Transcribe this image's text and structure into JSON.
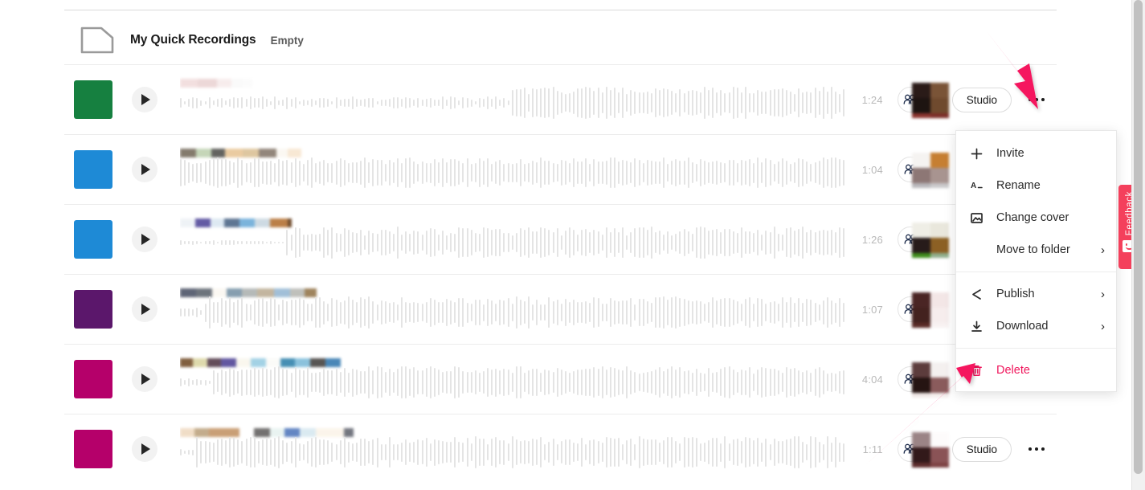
{
  "folder": {
    "icon": "folder-icon",
    "name": "My Quick Recordings",
    "status": "Empty"
  },
  "rows": [
    {
      "thumb_color": "#168040",
      "duration": "1:24",
      "studio_label": "Studio",
      "has_studio": true,
      "play_icon": "play-icon",
      "people_icon": "people-icon",
      "kebab_icon": "more-options-icon",
      "title_blur_colors": [
        "#f2dede",
        "#ecd6d6",
        "#f7ecec",
        "#fafafa",
        "#fbfbfb"
      ],
      "title_blur_widths": [
        22,
        24,
        18,
        14,
        12
      ],
      "avatar_blur_colors": [
        "#2a1b18",
        "#7a5437",
        "#1d1411",
        "#6f4a2e",
        "#8c3530",
        "#7d2f29"
      ]
    },
    {
      "thumb_color": "#1e8ad6",
      "duration": "1:04",
      "studio_label": "Studio",
      "has_studio": false,
      "play_icon": "play-icon",
      "people_icon": "people-icon",
      "kebab_icon": "more-options-icon",
      "title_blur_colors": [
        "#7e7465",
        "#c2d4b5",
        "#5b5b57",
        "#e9c99c",
        "#ddc49b",
        "#8d8074",
        "#fbf8f2",
        "#f8e7d2"
      ],
      "title_blur_widths": [
        20,
        19,
        17,
        22,
        20,
        22,
        14,
        17
      ],
      "avatar_blur_colors": [
        "#f5f3f1",
        "#c67f32",
        "#8d7775",
        "#a89490",
        "#b9b8bb",
        "#c9c8ca"
      ]
    },
    {
      "thumb_color": "#1e8ad6",
      "duration": "1:26",
      "studio_label": "Studio",
      "has_studio": false,
      "play_icon": "play-icon",
      "people_icon": "people-icon",
      "kebab_icon": "more-options-icon",
      "title_blur_colors": [
        "#eef2f6",
        "#5b52a0",
        "#dce8f2",
        "#566f8e",
        "#74b0da",
        "#ccd9e2",
        "#b8793e",
        "#6a4423"
      ],
      "title_blur_widths": [
        19,
        19,
        17,
        19,
        19,
        19,
        22,
        5
      ],
      "avatar_blur_colors": [
        "#efeee6",
        "#e9e7dc",
        "#271b1a",
        "#8c6024",
        "#3f8d1c",
        "#8fae8b",
        "#b02a22",
        "#2f5d16"
      ]
    },
    {
      "thumb_color": "#5b176b",
      "duration": "1:07",
      "studio_label": "Studio",
      "has_studio": false,
      "play_icon": "play-icon",
      "people_icon": "people-icon",
      "kebab_icon": "more-options-icon",
      "title_blur_colors": [
        "#565d6f",
        "#666d76",
        "#fbf8f2",
        "#8099ab",
        "#b2b7b5",
        "#c0b29a",
        "#9dbcd6",
        "#bcbdb8",
        "#9a7e55"
      ],
      "title_blur_widths": [
        20,
        20,
        18,
        19,
        19,
        21,
        20,
        18,
        15
      ],
      "avatar_blur_colors": [
        "#4a2524",
        "#f3e6e6",
        "#43221f",
        "#f6eded",
        "#5a2b27",
        "#f8f2f2"
      ]
    },
    {
      "thumb_color": "#b5006a",
      "duration": "4:04",
      "studio_label": "Studio",
      "has_studio": false,
      "play_icon": "play-icon",
      "people_icon": "people-icon",
      "kebab_icon": "more-options-icon",
      "title_blur_colors": [
        "#7b5634",
        "#ddd8a8",
        "#5c4452",
        "#5a4f9c",
        "#faf7ee",
        "#9fd0e4",
        "#fbfbf8",
        "#3d8ab0",
        "#85bfdb",
        "#4f4c4a",
        "#4081b4"
      ],
      "title_blur_widths": [
        16,
        18,
        17,
        19,
        18,
        19,
        18,
        18,
        19,
        19,
        19
      ],
      "avatar_blur_colors": [
        "#5c3c3c",
        "#f4f0ef",
        "#251412",
        "#8a5b5c",
        "#f0e8e6",
        "#f4eeed"
      ]
    },
    {
      "thumb_color": "#b5006a",
      "duration": "1:11",
      "studio_label": "Studio",
      "has_studio": true,
      "play_icon": "play-icon",
      "people_icon": "people-icon",
      "kebab_icon": "more-options-icon",
      "title_blur_colors": [
        "#f0dcc4",
        "#c0a886",
        "#c79a6f",
        "#ffffff",
        "#6c6a69",
        "#e8f3f1",
        "#5b80c0",
        "#d9e9f1",
        "#fbf4ea",
        "#6c6f79"
      ],
      "title_blur_widths": [
        18,
        18,
        38,
        18,
        20,
        18,
        19,
        20,
        35,
        12
      ],
      "avatar_blur_colors": [
        "#9b8486",
        "#fdfbfb",
        "#32191a",
        "#8a5356",
        "#5e2d2d",
        "#7e4344"
      ]
    }
  ],
  "context_menu": {
    "groups": [
      [
        {
          "icon": "plus-icon",
          "label": "Invite",
          "submenu": false,
          "danger": false
        },
        {
          "icon": "rename-text-icon",
          "label": "Rename",
          "submenu": false,
          "danger": false
        },
        {
          "icon": "image-icon",
          "label": "Change cover",
          "submenu": false,
          "danger": false
        },
        {
          "icon": "none",
          "label": "Move to folder",
          "submenu": true,
          "danger": false
        }
      ],
      [
        {
          "icon": "share-icon",
          "label": "Publish",
          "submenu": true,
          "danger": false
        },
        {
          "icon": "download-icon",
          "label": "Download",
          "submenu": true,
          "danger": false
        }
      ],
      [
        {
          "icon": "trash-icon",
          "label": "Delete",
          "submenu": false,
          "danger": true
        }
      ]
    ],
    "chevron": "›",
    "danger_color": "#f0165c"
  },
  "feedback": {
    "label": "Feedback",
    "icon": "smiley-face-icon",
    "color": "#f4405c"
  },
  "annotations": {
    "arrow_color": "#f5175e",
    "arrow_1_target": "more-options-icon",
    "arrow_2_target": "delete-menu-item"
  }
}
